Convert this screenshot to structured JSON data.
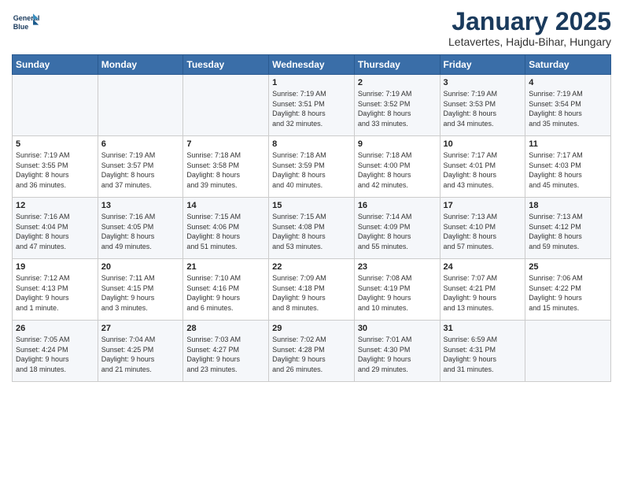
{
  "header": {
    "logo_line1": "General",
    "logo_line2": "Blue",
    "month_title": "January 2025",
    "location": "Letavertes, Hajdu-Bihar, Hungary"
  },
  "days_of_week": [
    "Sunday",
    "Monday",
    "Tuesday",
    "Wednesday",
    "Thursday",
    "Friday",
    "Saturday"
  ],
  "weeks": [
    [
      {
        "day": "",
        "info": ""
      },
      {
        "day": "",
        "info": ""
      },
      {
        "day": "",
        "info": ""
      },
      {
        "day": "1",
        "info": "Sunrise: 7:19 AM\nSunset: 3:51 PM\nDaylight: 8 hours\nand 32 minutes."
      },
      {
        "day": "2",
        "info": "Sunrise: 7:19 AM\nSunset: 3:52 PM\nDaylight: 8 hours\nand 33 minutes."
      },
      {
        "day": "3",
        "info": "Sunrise: 7:19 AM\nSunset: 3:53 PM\nDaylight: 8 hours\nand 34 minutes."
      },
      {
        "day": "4",
        "info": "Sunrise: 7:19 AM\nSunset: 3:54 PM\nDaylight: 8 hours\nand 35 minutes."
      }
    ],
    [
      {
        "day": "5",
        "info": "Sunrise: 7:19 AM\nSunset: 3:55 PM\nDaylight: 8 hours\nand 36 minutes."
      },
      {
        "day": "6",
        "info": "Sunrise: 7:19 AM\nSunset: 3:57 PM\nDaylight: 8 hours\nand 37 minutes."
      },
      {
        "day": "7",
        "info": "Sunrise: 7:18 AM\nSunset: 3:58 PM\nDaylight: 8 hours\nand 39 minutes."
      },
      {
        "day": "8",
        "info": "Sunrise: 7:18 AM\nSunset: 3:59 PM\nDaylight: 8 hours\nand 40 minutes."
      },
      {
        "day": "9",
        "info": "Sunrise: 7:18 AM\nSunset: 4:00 PM\nDaylight: 8 hours\nand 42 minutes."
      },
      {
        "day": "10",
        "info": "Sunrise: 7:17 AM\nSunset: 4:01 PM\nDaylight: 8 hours\nand 43 minutes."
      },
      {
        "day": "11",
        "info": "Sunrise: 7:17 AM\nSunset: 4:03 PM\nDaylight: 8 hours\nand 45 minutes."
      }
    ],
    [
      {
        "day": "12",
        "info": "Sunrise: 7:16 AM\nSunset: 4:04 PM\nDaylight: 8 hours\nand 47 minutes."
      },
      {
        "day": "13",
        "info": "Sunrise: 7:16 AM\nSunset: 4:05 PM\nDaylight: 8 hours\nand 49 minutes."
      },
      {
        "day": "14",
        "info": "Sunrise: 7:15 AM\nSunset: 4:06 PM\nDaylight: 8 hours\nand 51 minutes."
      },
      {
        "day": "15",
        "info": "Sunrise: 7:15 AM\nSunset: 4:08 PM\nDaylight: 8 hours\nand 53 minutes."
      },
      {
        "day": "16",
        "info": "Sunrise: 7:14 AM\nSunset: 4:09 PM\nDaylight: 8 hours\nand 55 minutes."
      },
      {
        "day": "17",
        "info": "Sunrise: 7:13 AM\nSunset: 4:10 PM\nDaylight: 8 hours\nand 57 minutes."
      },
      {
        "day": "18",
        "info": "Sunrise: 7:13 AM\nSunset: 4:12 PM\nDaylight: 8 hours\nand 59 minutes."
      }
    ],
    [
      {
        "day": "19",
        "info": "Sunrise: 7:12 AM\nSunset: 4:13 PM\nDaylight: 9 hours\nand 1 minute."
      },
      {
        "day": "20",
        "info": "Sunrise: 7:11 AM\nSunset: 4:15 PM\nDaylight: 9 hours\nand 3 minutes."
      },
      {
        "day": "21",
        "info": "Sunrise: 7:10 AM\nSunset: 4:16 PM\nDaylight: 9 hours\nand 6 minutes."
      },
      {
        "day": "22",
        "info": "Sunrise: 7:09 AM\nSunset: 4:18 PM\nDaylight: 9 hours\nand 8 minutes."
      },
      {
        "day": "23",
        "info": "Sunrise: 7:08 AM\nSunset: 4:19 PM\nDaylight: 9 hours\nand 10 minutes."
      },
      {
        "day": "24",
        "info": "Sunrise: 7:07 AM\nSunset: 4:21 PM\nDaylight: 9 hours\nand 13 minutes."
      },
      {
        "day": "25",
        "info": "Sunrise: 7:06 AM\nSunset: 4:22 PM\nDaylight: 9 hours\nand 15 minutes."
      }
    ],
    [
      {
        "day": "26",
        "info": "Sunrise: 7:05 AM\nSunset: 4:24 PM\nDaylight: 9 hours\nand 18 minutes."
      },
      {
        "day": "27",
        "info": "Sunrise: 7:04 AM\nSunset: 4:25 PM\nDaylight: 9 hours\nand 21 minutes."
      },
      {
        "day": "28",
        "info": "Sunrise: 7:03 AM\nSunset: 4:27 PM\nDaylight: 9 hours\nand 23 minutes."
      },
      {
        "day": "29",
        "info": "Sunrise: 7:02 AM\nSunset: 4:28 PM\nDaylight: 9 hours\nand 26 minutes."
      },
      {
        "day": "30",
        "info": "Sunrise: 7:01 AM\nSunset: 4:30 PM\nDaylight: 9 hours\nand 29 minutes."
      },
      {
        "day": "31",
        "info": "Sunrise: 6:59 AM\nSunset: 4:31 PM\nDaylight: 9 hours\nand 31 minutes."
      },
      {
        "day": "",
        "info": ""
      }
    ]
  ]
}
